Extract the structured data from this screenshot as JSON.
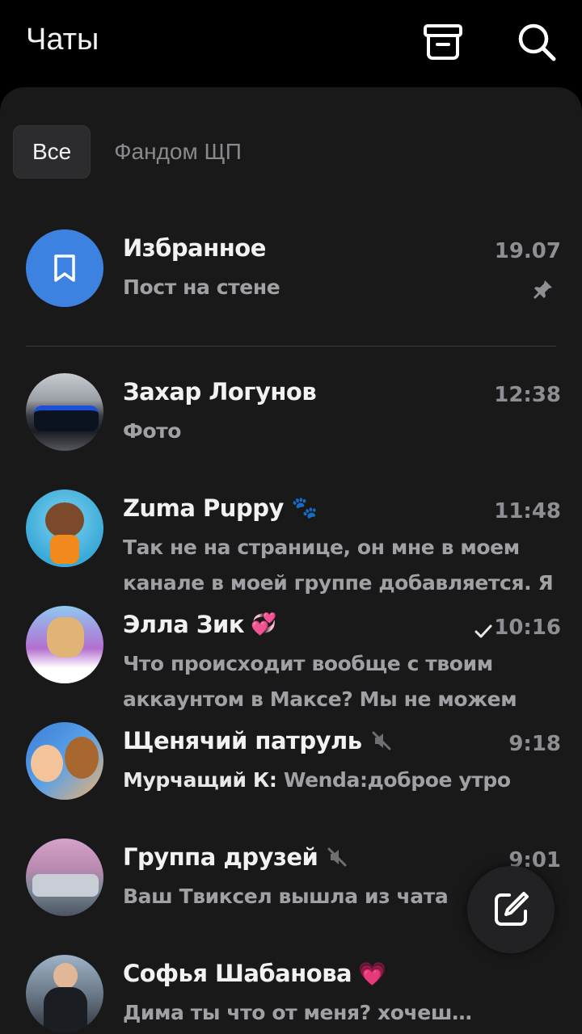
{
  "header": {
    "title": "Чаты",
    "archive_icon": "archive-icon",
    "search_icon": "search-icon"
  },
  "tabs": [
    {
      "label": "Все",
      "active": true
    },
    {
      "label": "Фандом ЩП",
      "active": false
    }
  ],
  "chats": [
    {
      "name": "Избранное",
      "time": "19.07",
      "preview": "Пост на стене",
      "pinned": true,
      "avatar": "bookmark-icon"
    },
    {
      "name": "Захар Логунов",
      "time": "12:38",
      "preview": "Фото"
    },
    {
      "name": "Zuma Puppy",
      "emoji": "🐾",
      "time": "11:48",
      "preview": "Так не на странице, он мне в моем канале в моей группе добавляется. Я ..."
    },
    {
      "name": "Элла Зик",
      "emoji": "💞",
      "time": "10:16",
      "read": true,
      "preview": "Что происходит вообще с твоим аккаунтом в Максе? Мы не можем отл..."
    },
    {
      "name": "Щенячий патруль",
      "time": "9:18",
      "muted": true,
      "sender": "Мурчащий К:",
      "preview": " Wenda:доброе утро"
    },
    {
      "name": "Группа друзей",
      "time": "9:01",
      "muted": true,
      "preview": "Ваш Твиксел вышла из чата"
    },
    {
      "name": "Софья Шабанова",
      "emoji": "💗",
      "time": "",
      "preview": "Дима ты что от меня? хочешь з..."
    }
  ],
  "fab": {
    "icon": "compose-icon"
  },
  "colors": {
    "background": "#000000",
    "panel": "#19191a",
    "accent": "#3d82e0",
    "text_secondary": "#8e8e93"
  }
}
